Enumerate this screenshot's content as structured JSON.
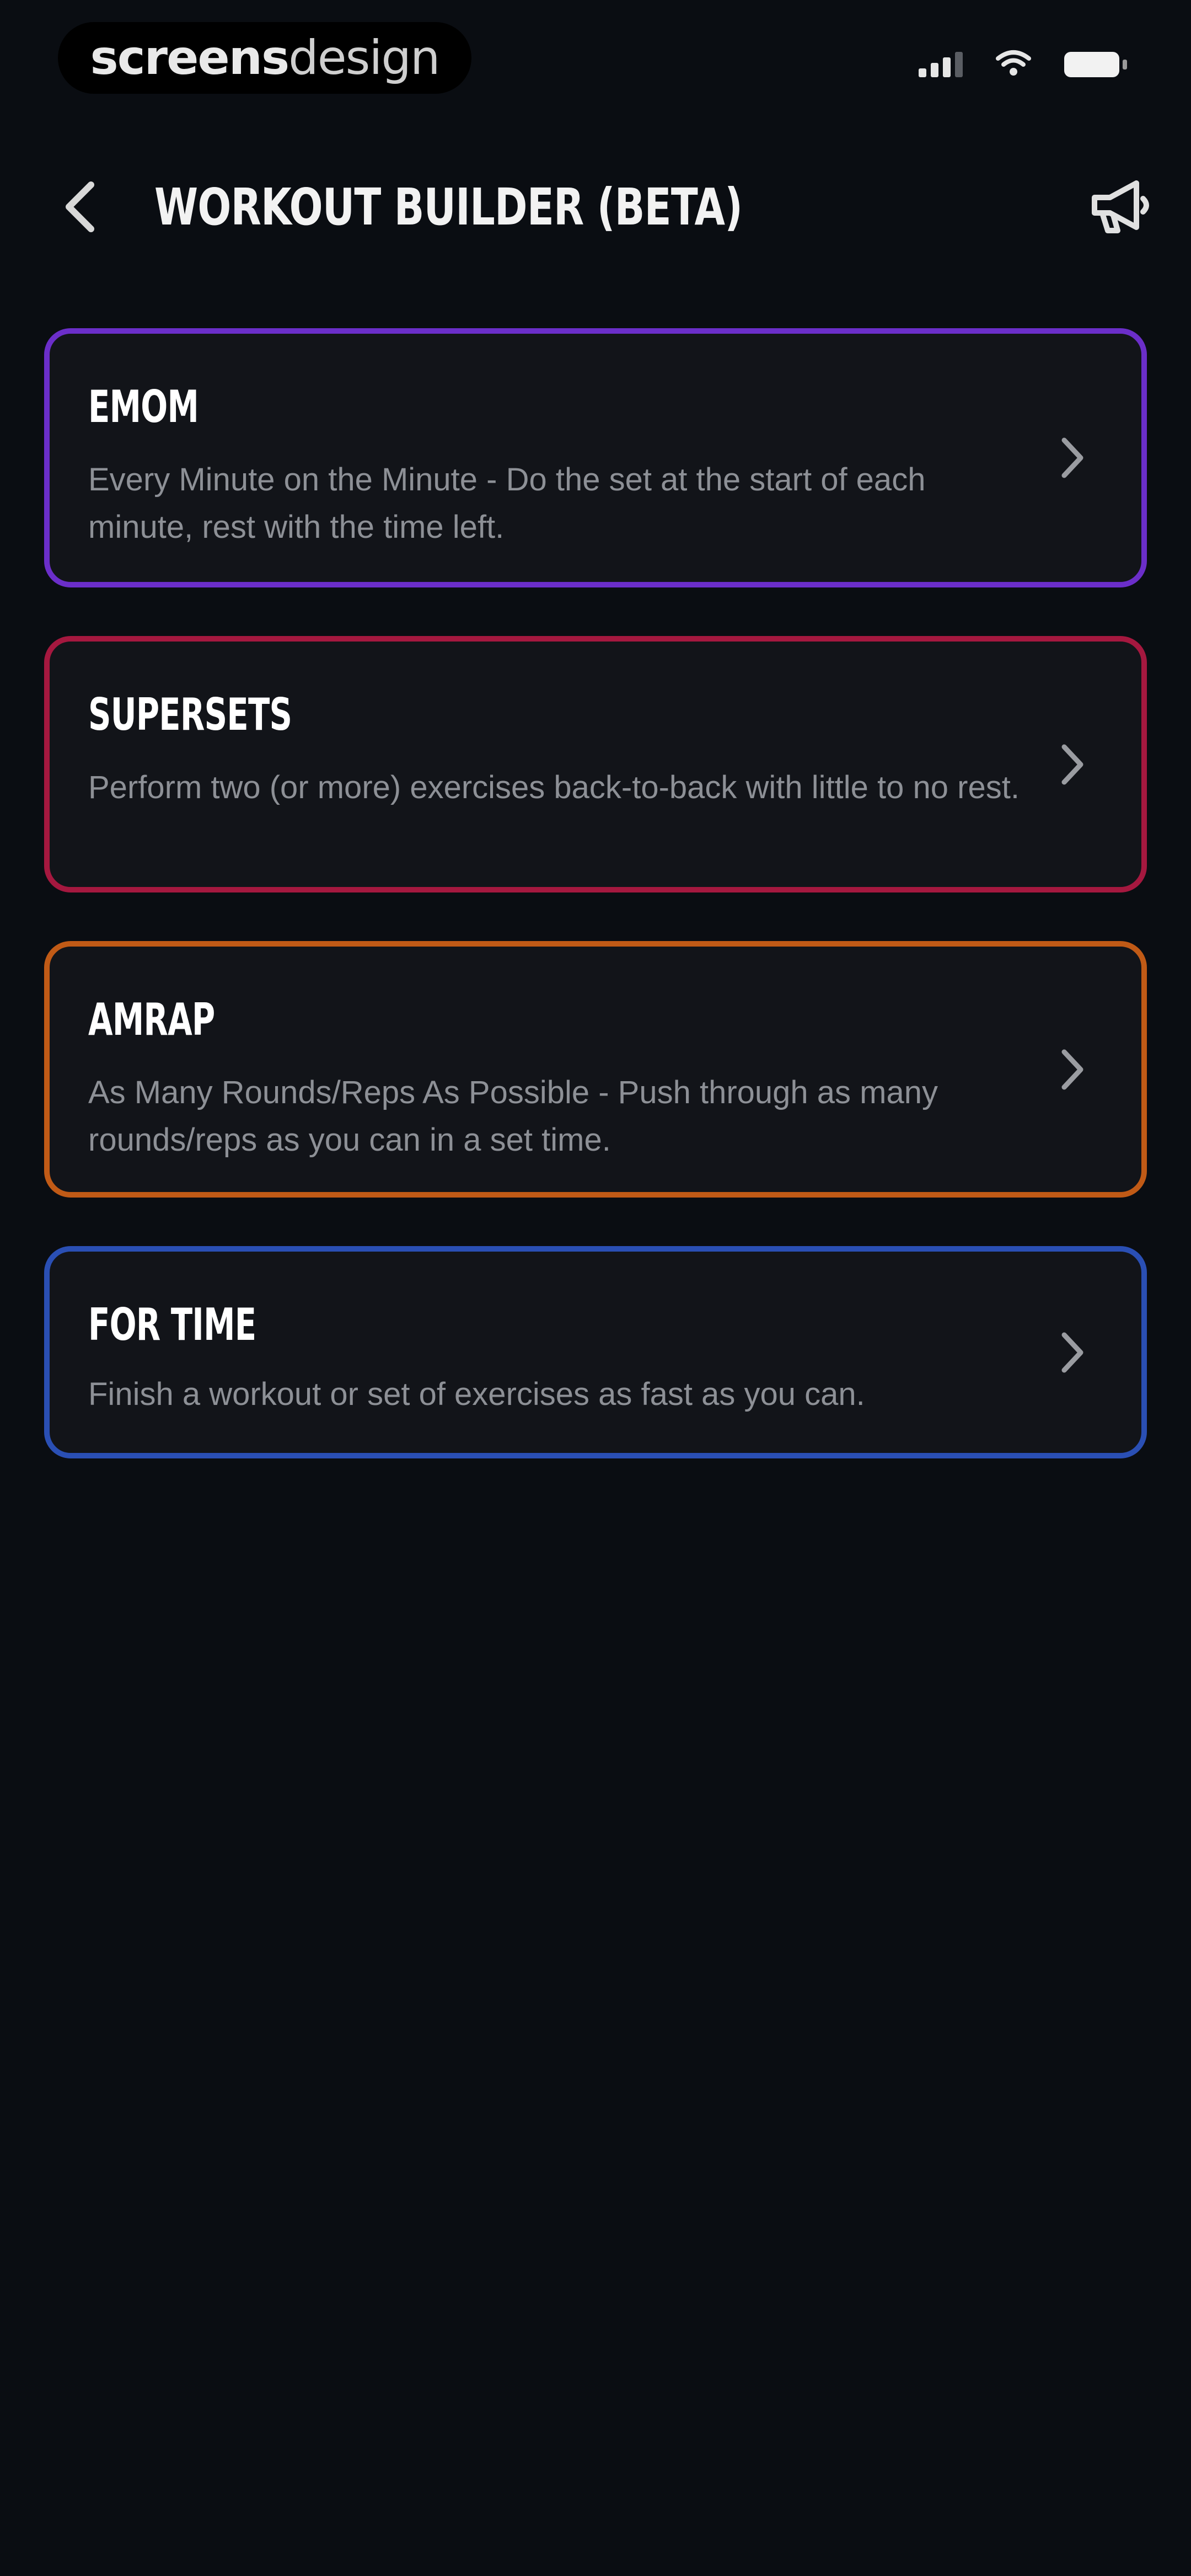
{
  "status_bar": {
    "brand_bold": "screens",
    "brand_light": "design"
  },
  "header": {
    "title": "WORKOUT BUILDER (BETA)"
  },
  "workout_types": [
    {
      "title": "EMOM",
      "description": "Every Minute on the Minute - Do the set at the start of each minute, rest with the time left.",
      "accent": "#6b2ec9"
    },
    {
      "title": "SUPERSETS",
      "description": "Perform two (or more) exercises back-to-back with little to no rest.",
      "accent": "#a5183f"
    },
    {
      "title": "AMRAP",
      "description": "As Many Rounds/Reps As Possible - Push through as many rounds/reps as you can in a set time.",
      "accent": "#c05a16"
    },
    {
      "title": "FOR TIME",
      "description": "Finish a workout or set of exercises as fast as you can.",
      "accent": "#2a4fb4"
    }
  ],
  "icons": {
    "back": "chevron-left-icon",
    "announce": "megaphone-icon",
    "card_arrow": "chevron-right-icon",
    "signal": "cellular-signal-icon",
    "wifi": "wifi-icon",
    "battery": "battery-icon"
  }
}
